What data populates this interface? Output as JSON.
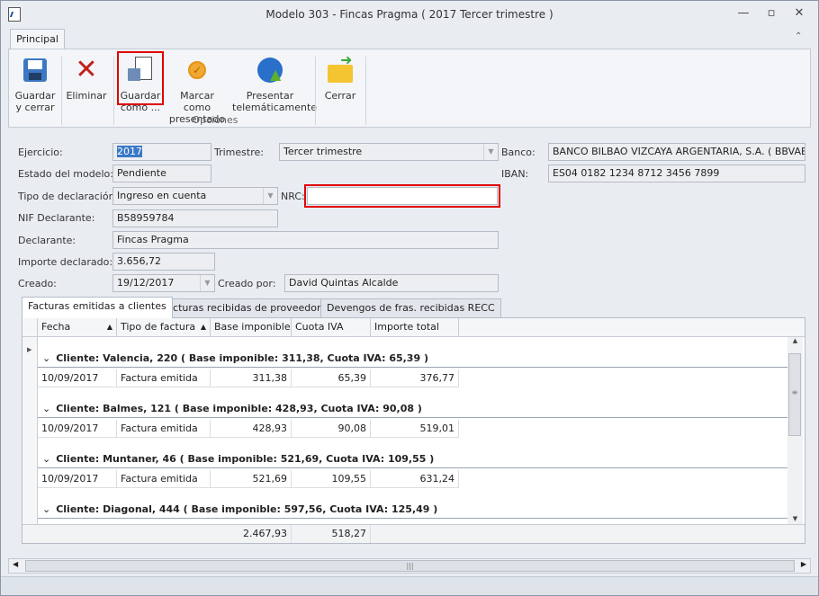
{
  "window": {
    "title": "Modelo 303 - Fincas Pragma ( 2017 Tercer trimestre )",
    "minimize": "—",
    "restore": "▫",
    "close": "✕"
  },
  "ribbon": {
    "tab": "Principal",
    "collapse": "⌃",
    "group_label": "Opciones",
    "buttons": [
      {
        "line1": "Guardar",
        "line2": "y cerrar"
      },
      {
        "line1": "Eliminar",
        "line2": ""
      },
      {
        "line1": "Guardar",
        "line2": "como ..."
      },
      {
        "line1": "Marcar como",
        "line2": "presentado"
      },
      {
        "line1": "Presentar",
        "line2": "telemáticamente"
      },
      {
        "line1": "Cerrar",
        "line2": ""
      }
    ]
  },
  "form": {
    "ejercicio_label": "Ejercicio:",
    "ejercicio": "2017",
    "trimestre_label": "Trimestre:",
    "trimestre": "Tercer trimestre",
    "banco_label": "Banco:",
    "banco": "BANCO BILBAO VIZCAYA ARGENTARIA, S.A. ( BBVAESMM",
    "estado_label": "Estado del modelo:",
    "estado": "Pendiente",
    "iban_label": "IBAN:",
    "iban": "ES04 0182 1234 8712 3456 7899",
    "tipo_label": "Tipo de declaración:",
    "tipo": "Ingreso en cuenta",
    "nrc_label": "NRC:",
    "nrc": "",
    "nif_label": "NIF Declarante:",
    "nif": "B58959784",
    "declarante_label": "Declarante:",
    "declarante": "Fincas Pragma",
    "importe_label": "Importe declarado:",
    "importe": "3.656,72",
    "creado_label": "Creado:",
    "creado": "19/12/2017",
    "creado_por_label": "Creado por:",
    "creado_por": "David Quintas Alcalde"
  },
  "tabs": [
    "Facturas emitidas a clientes",
    "Facturas recibidas de proveedores",
    "Devengos de fras. recibidas RECC"
  ],
  "grid": {
    "columns": [
      "Fecha",
      "Tipo de factura",
      "Base imponible",
      "Cuota IVA",
      "Importe total"
    ],
    "groups": [
      {
        "title": "Cliente: Valencia, 220 ( Base imponible: 311,38, Cuota IVA: 65,39 )",
        "rows": [
          [
            "10/09/2017",
            "Factura emitida",
            "311,38",
            "65,39",
            "376,77"
          ]
        ]
      },
      {
        "title": "Cliente: Balmes, 121 ( Base imponible: 428,93, Cuota IVA: 90,08 )",
        "rows": [
          [
            "10/09/2017",
            "Factura emitida",
            "428,93",
            "90,08",
            "519,01"
          ]
        ]
      },
      {
        "title": "Cliente: Muntaner, 46 ( Base imponible: 521,69, Cuota IVA: 109,55 )",
        "rows": [
          [
            "10/09/2017",
            "Factura emitida",
            "521,69",
            "109,55",
            "631,24"
          ]
        ]
      },
      {
        "title": "Cliente: Diagonal, 444 ( Base imponible: 597,56, Cuota IVA: 125,49 )",
        "rows": []
      }
    ],
    "totals": {
      "base": "2.467,93",
      "cuota": "518,27"
    }
  }
}
